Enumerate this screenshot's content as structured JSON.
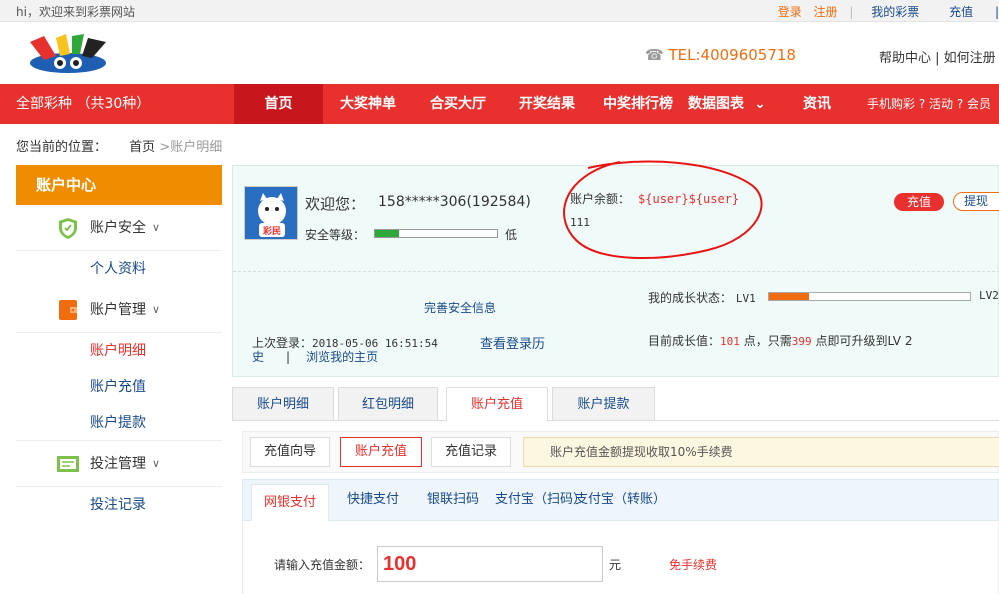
{
  "topbar": {
    "welcome": "hi，欢迎来到彩票网站",
    "login": "登录",
    "register": "注册",
    "my_lottery": "我的彩票",
    "recharge": "充值",
    "colors": {
      "orange": "#f06d0f",
      "link_blue": "#1a4a8a"
    }
  },
  "header": {
    "tel": "TEL:4009605718",
    "help": "帮助中心 |  如何注册"
  },
  "nav": {
    "all_types": "全部彩种 （共30种）",
    "items": [
      "首页",
      "大奖神单",
      "合买大厅",
      "开奖结果",
      "中奖排行榜",
      "数据图表",
      "资讯"
    ],
    "mobile": "手机购彩 ? 活动 ? 会员",
    "colors": {
      "bar": "#e8302e",
      "active": "#c8161d"
    }
  },
  "breadcrumb": {
    "label": "您当前的位置：",
    "home": "首页",
    "current": ">账户明细"
  },
  "sidebar": {
    "title": "账户中心",
    "groups": [
      {
        "label": "账户安全",
        "icon": "shield-icon",
        "items": [
          "个人资料"
        ]
      },
      {
        "label": "账户管理",
        "icon": "wallet-icon",
        "items": [
          "账户明细",
          "账户充值",
          "账户提款"
        ]
      },
      {
        "label": "投注管理",
        "icon": "ticket-icon",
        "items": [
          "投注记录"
        ]
      }
    ],
    "color": "#f08c00"
  },
  "profile": {
    "hello": "欢迎您：",
    "username": "158*****306(192584)",
    "security_label": "安全等级：",
    "security_level": "低",
    "security_fill": 0.2,
    "balance_label": "账户余额：",
    "balance_value": "${user}${user}",
    "balance_extra": "111",
    "recharge_btn": "充值",
    "withdraw_btn": "提现",
    "perfect_info": "完善安全信息",
    "growth_label": "我的成长状态：",
    "lv_from": "LV1",
    "lv_to": "LV2",
    "growth_fill": 0.2,
    "last_login_label": "上次登录：",
    "last_login_time": "2018-05-06 16:51:54",
    "view_login": "查看登录历",
    "history": "史",
    "sep": "|",
    "browse": "浏览我的主页",
    "growth_value_label": "目前成长值：",
    "growth_value": "101",
    "growth_unit": "点，只需",
    "need": "399",
    "need_suffix": "点即可升级到LV 2",
    "avatar_text": "彩民"
  },
  "tabs": [
    "账户明细",
    "红包明细",
    "账户充值",
    "账户提款"
  ],
  "subtabs": [
    "充值向导",
    "账户充值",
    "充值记录"
  ],
  "notice": "账户充值金额提现收取10%手续费",
  "paytabs": [
    "网银支付",
    "快捷支付",
    "银联扫码",
    "支付宝（扫码）",
    "支付宝（转账）"
  ],
  "payform": {
    "label": "请输入充值金额：",
    "amount": "100",
    "unit": "元",
    "free": "免手续费"
  }
}
